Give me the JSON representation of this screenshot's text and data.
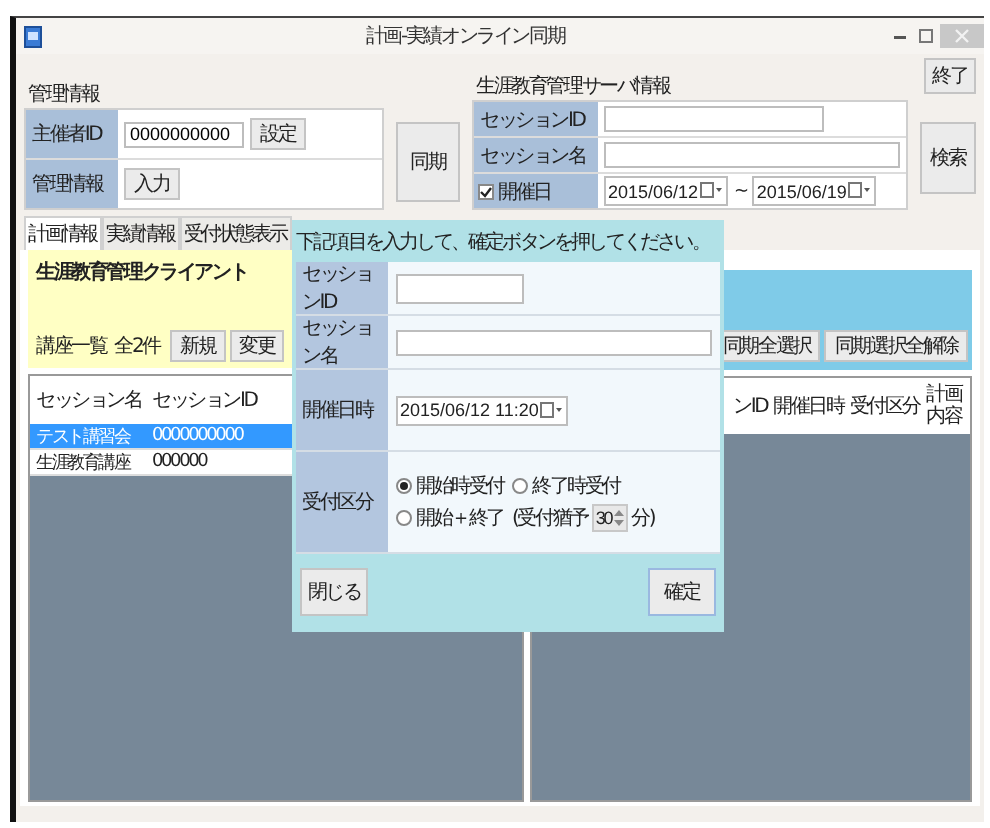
{
  "window": {
    "title": "計画-実績オンライン同期"
  },
  "exit_button": "終了",
  "admin_group": {
    "title": "管理情報",
    "id_label": "主催者ID",
    "id_value": "0000000000",
    "id_button": "設定",
    "info_label": "管理情報",
    "info_button": "入力"
  },
  "sync_button": "同期",
  "server_group": {
    "title": "生涯教育管理サーバ情報",
    "session_id_label": "セッションID",
    "session_name_label": "セッション名",
    "date_label": "開催日",
    "date_checked": true,
    "date_from": "2015/06/12",
    "separator": "~",
    "date_to": "2015/06/19"
  },
  "search_button": "検索",
  "tabs": [
    {
      "label": "計画情報",
      "selected": true
    },
    {
      "label": "実績情報",
      "selected": false
    },
    {
      "label": "受付状態表示",
      "selected": false
    }
  ],
  "client_panel": {
    "title": "生涯教育管理クライアント",
    "list_label": "講座一覧",
    "count": "全2件",
    "buttons": [
      "新規",
      "変更"
    ]
  },
  "left_table": {
    "columns": [
      "セッション名",
      "セッションID"
    ],
    "rows": [
      {
        "cells": [
          "テスト講習会",
          "0000000000"
        ],
        "selected": true
      },
      {
        "cells": [
          "生涯教育講座",
          "000000"
        ],
        "selected": false
      }
    ]
  },
  "right_panel": {
    "buttons": [
      "同期全選択",
      "同期選択全解除"
    ],
    "columns": [
      "ンID",
      "開催日時",
      "受付区分",
      "計画内容"
    ]
  },
  "dialog": {
    "message": "下記項目を入力して、確定ボタンを押してください。",
    "session_id_label": "セッションID",
    "session_name_label": "セッション名",
    "datetime_label": "開催日時",
    "datetime": "2015/06/12 11:20",
    "reception_label": "受付区分",
    "options": [
      {
        "label": "開始時受付",
        "selected": true
      },
      {
        "label": "終了時受付",
        "selected": false
      },
      {
        "label": "開始＋終了",
        "selected": false
      }
    ],
    "grace_label": "(受付猶予",
    "grace_value": "30",
    "grace_unit": "分)",
    "close_button": "閉じる",
    "ok_button": "確定"
  }
}
